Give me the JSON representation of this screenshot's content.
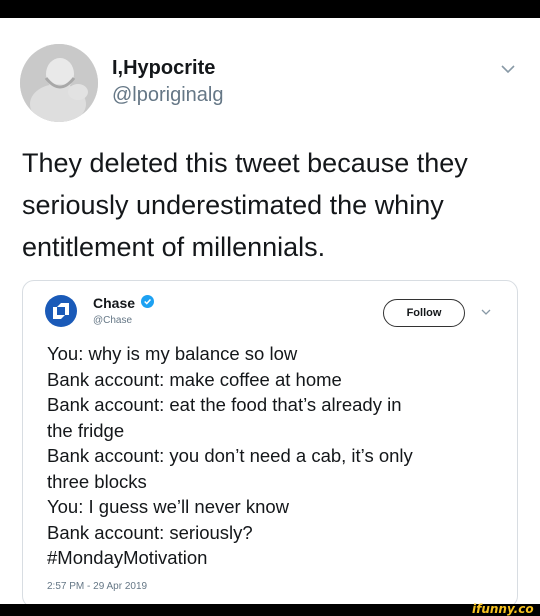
{
  "header": {
    "author_name": "I,Hypocrite",
    "author_handle": "@lporiginalg"
  },
  "tweet": {
    "text_lines": [
      "They deleted this tweet because they",
      "seriously underestimated the whiny",
      "entitlement of millennials."
    ]
  },
  "quoted": {
    "name": "Chase",
    "handle": "@Chase",
    "follow_label": "Follow",
    "lines": [
      "You: why is my balance so low",
      "Bank account: make coffee at home",
      "Bank account: eat the food that’s already in",
      "the fridge",
      "Bank account: you don’t need a cab, it’s only",
      "three blocks",
      "You: I guess we’ll never know",
      "Bank account: seriously?",
      "#MondayMotivation"
    ],
    "timestamp": "2:57 PM - 29 Apr 2019"
  },
  "watermark": "ifunny.co",
  "colors": {
    "verified": "#1da1f2",
    "chase_blue": "#1a5ab8",
    "watermark": "#f7c21f"
  }
}
